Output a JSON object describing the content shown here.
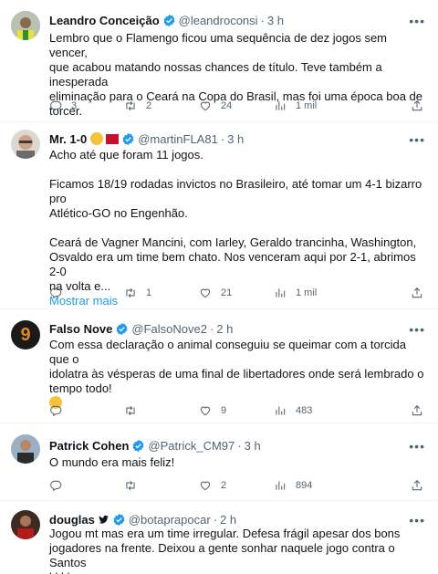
{
  "icons": [
    "verified-badge-icon",
    "more-icon",
    "reply-icon",
    "retweet-icon",
    "like-icon",
    "views-icon",
    "share-icon"
  ],
  "colors": {
    "accent": "#1d9bf0",
    "muted": "#536471",
    "text": "#0f1419",
    "border": "#eff3f4"
  },
  "tweets": [
    {
      "name": "Leandro Conceição",
      "handle": "@leandroconsi",
      "dot": "·",
      "time": "3 h",
      "lines": [
        "Lembro que o Flamengo ficou uma sequência de dez jogos sem vencer,",
        "que acabou matando nossas chances de título. Teve também a inesperada",
        "eliminação para o Ceará na Copa do Brasil, mas foi uma época boa de",
        "torcer."
      ],
      "replies": "3",
      "retweets": "2",
      "likes": "24",
      "views": "1 mil"
    },
    {
      "name": "Mr. 1-0",
      "handle": "@martinFLA81",
      "dot": "·",
      "time": "3 h",
      "lines": [
        "Acho até que foram 11 jogos.",
        "",
        "Ficamos 18/19 rodadas invictos no Brasileiro, até tomar um 4-1 bizarro pro",
        "Atlético-GO no Engenhão.",
        "",
        "Ceará de Vagner Mancini, com Iarley, Geraldo trancinha, Washington,",
        "Osvaldo era um time bem chato. Nos venceram aqui por 2-1, abrimos 2-0",
        "na volta e..."
      ],
      "show_more": "Mostrar mais",
      "replies": "",
      "retweets": "1",
      "likes": "21",
      "views": "1 mil"
    },
    {
      "name": "Falso Nove",
      "handle": "@FalsoNove2",
      "dot": "·",
      "time": "2 h",
      "lines": [
        "Com essa declaração o animal conseguiu se queimar com a torcida que o",
        "idolatra às vésperas de uma final de libertadores onde será lembrado o",
        "tempo todo!",
        ""
      ],
      "avatar_text": "9",
      "replies": "",
      "retweets": "",
      "likes": "9",
      "views": "483"
    },
    {
      "name": "Patrick Cohen",
      "handle": "@Patrick_CM97",
      "dot": "·",
      "time": "3 h",
      "lines": [
        "O mundo era mais feliz!"
      ],
      "replies": "",
      "retweets": "",
      "likes": "2",
      "views": "894"
    },
    {
      "name": "douglas",
      "handle": "@botaprapocar",
      "dot": "·",
      "time": "2 h",
      "lines": [
        "Jogou mt mas era um time irregular. Defesa frágil apesar dos bons",
        "jogadores na frente. Deixou a gente sonhar naquele jogo contra o Santos",
        "kkkk"
      ]
    }
  ]
}
